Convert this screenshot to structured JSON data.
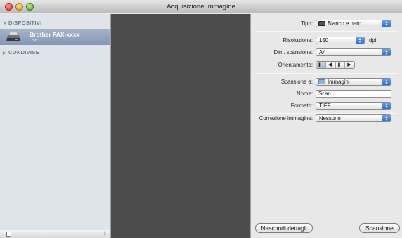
{
  "window": {
    "title": "Acquisizione Immagine"
  },
  "sidebar": {
    "devices_heading": "DISPOSITIVI",
    "device": {
      "name": "Brother FAX-xxxx",
      "connection": "USB",
      "icon": "printer-icon"
    },
    "shared_heading": "CONDIVISE"
  },
  "settings": {
    "type": {
      "label": "Tipo:",
      "value": "Bianco e nero"
    },
    "resolution": {
      "label": "Risoluzione:",
      "value": "150",
      "unit": "dpi"
    },
    "scan_size": {
      "label": "Dim. scansione:",
      "value": "A4"
    },
    "orientation": {
      "label": "Orientamento:",
      "options": [
        "portrait-icon",
        "rotate-left-icon",
        "portrait-flipped-icon",
        "rotate-right-icon"
      ],
      "selected": 0
    },
    "scan_to": {
      "label": "Scansione a:",
      "value": "Immagini"
    },
    "name": {
      "label": "Nome:",
      "value": "Scan"
    },
    "format": {
      "label": "Formato:",
      "value": "TIFF"
    },
    "image_correction": {
      "label": "Correzione immagine:",
      "value": "Nessuno"
    }
  },
  "buttons": {
    "hide_details": "Nascondi dettagli",
    "scan": "Scansione"
  },
  "colors": {
    "sidebar_selected": "#8fa1bb",
    "preview_bg": "#4c4c4c",
    "accent_blue": "#2c6ed3"
  }
}
